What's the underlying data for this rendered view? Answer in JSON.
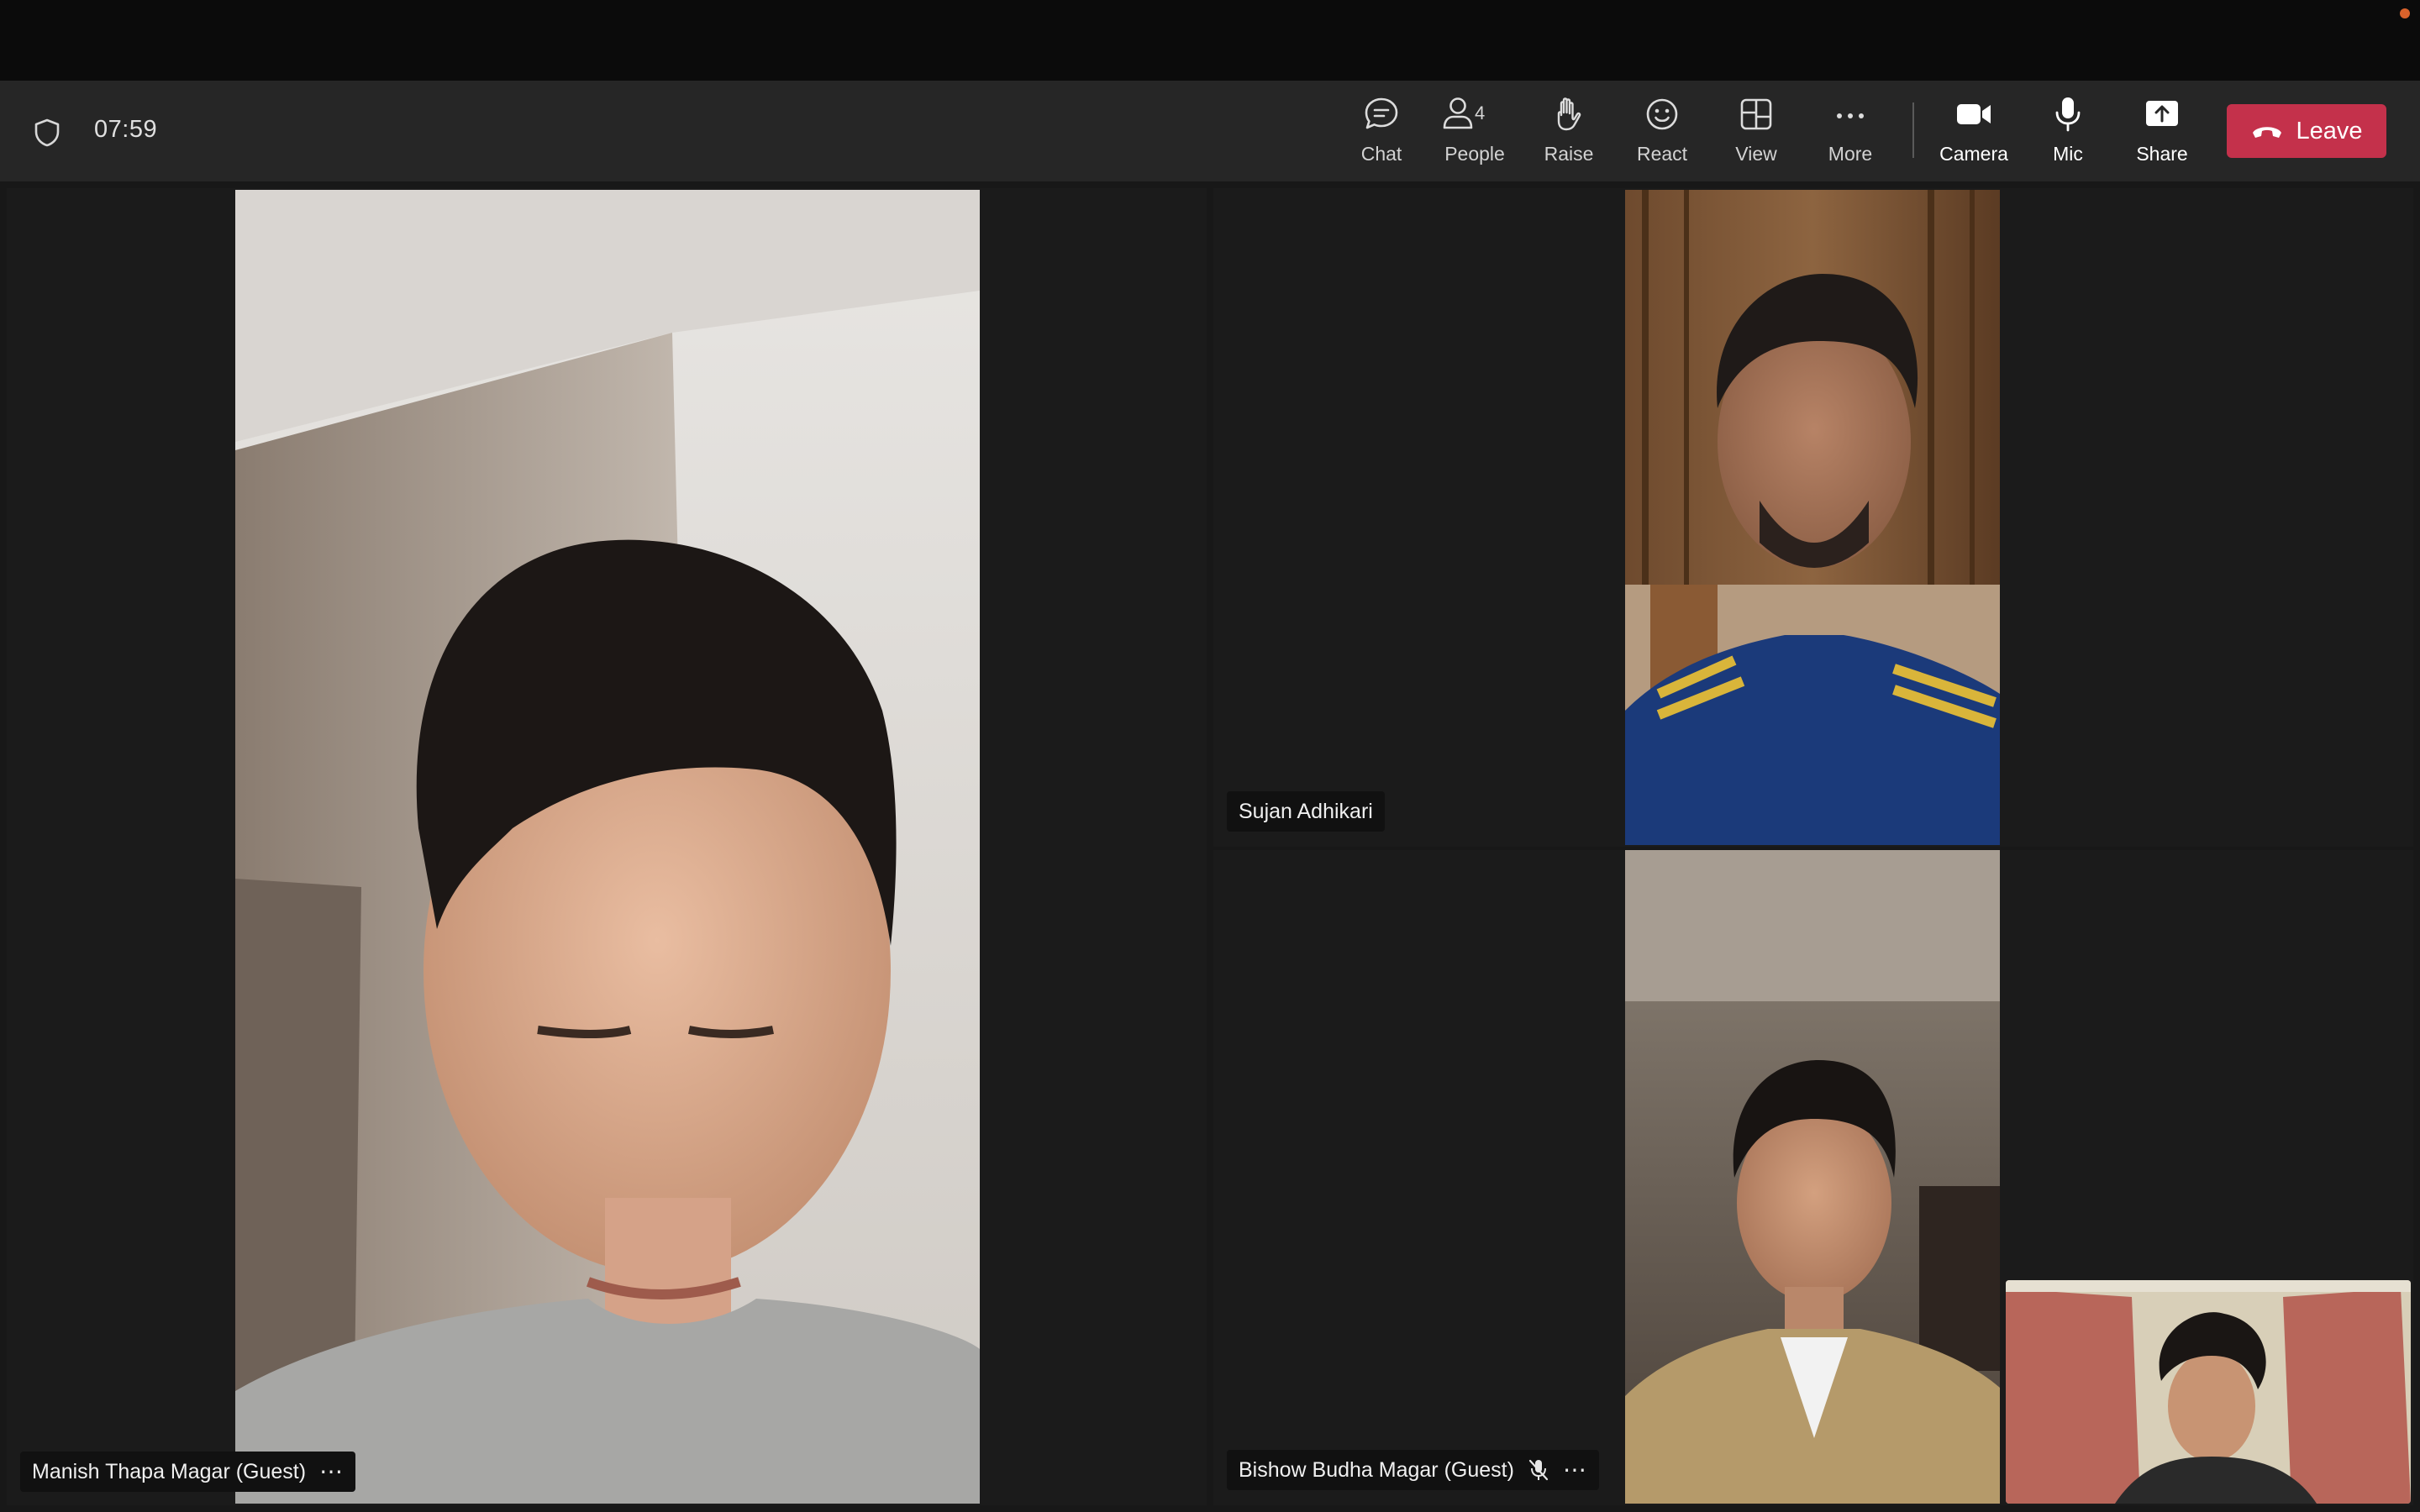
{
  "meeting": {
    "timer": "07:59"
  },
  "toolbar": {
    "chat_label": "Chat",
    "people_label": "People",
    "people_count": "4",
    "raise_label": "Raise",
    "react_label": "React",
    "view_label": "View",
    "more_label": "More",
    "camera_label": "Camera",
    "mic_label": "Mic",
    "share_label": "Share",
    "leave_label": "Leave"
  },
  "participants": [
    {
      "name": "Manish Thapa Magar (Guest)",
      "muted": false
    },
    {
      "name": "Sujan Adhikari",
      "muted": false
    },
    {
      "name": "Bishow Budha Magar (Guest)",
      "muted": true
    }
  ],
  "colors": {
    "leave_button": "#c4314b",
    "toolbar_bg": "#262626",
    "stage_bg": "#181818",
    "recording_dot": "#d9622b"
  },
  "icons": [
    "shield-icon",
    "chat-icon",
    "people-icon",
    "raise-hand-icon",
    "react-icon",
    "view-icon",
    "more-icon",
    "camera-icon",
    "mic-icon",
    "share-icon",
    "phone-hangup-icon",
    "mic-off-icon"
  ]
}
